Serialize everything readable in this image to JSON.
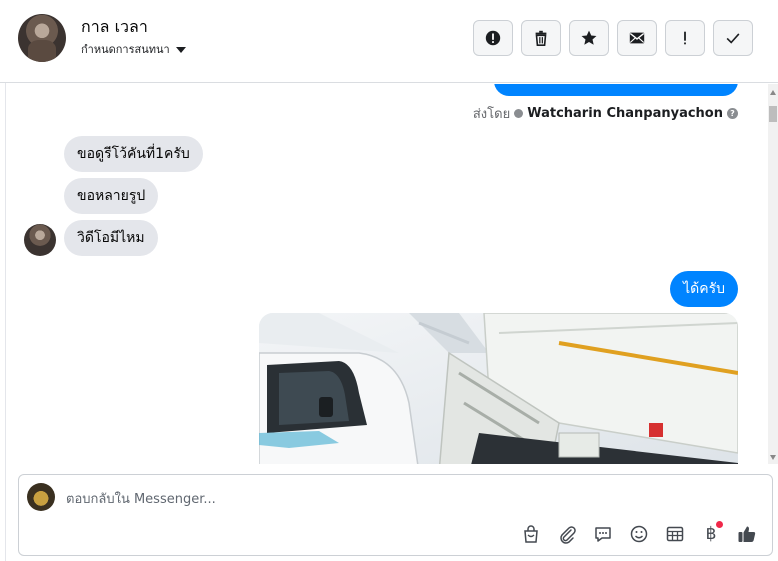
{
  "header": {
    "contact_name": "กาล เวลา",
    "assign_label": "กำหนดการสนทนา",
    "toolbar": [
      {
        "name": "spam-icon",
        "label": "!"
      },
      {
        "name": "trash-icon",
        "label": ""
      },
      {
        "name": "star-icon",
        "label": ""
      },
      {
        "name": "mail-icon",
        "label": ""
      },
      {
        "name": "exclamation-icon",
        "label": "!"
      },
      {
        "name": "check-icon",
        "label": ""
      }
    ]
  },
  "chat": {
    "sent_by_prefix": "ส่งโดย",
    "sent_by_name": "Watcharin Chanpanyachon",
    "incoming": [
      "ขอดูรีโว้คันที่1ครับ",
      "ขอหลายรูป",
      "วิดีโอมีไหม"
    ],
    "outgoing": "ได้ครับ"
  },
  "composer": {
    "placeholder": "ตอบกลับใน Messenger...",
    "icons": [
      "shopping-bag-icon",
      "attachment-icon",
      "saved-reply-icon",
      "emoji-icon",
      "table-icon",
      "baht-icon",
      "like-icon"
    ],
    "baht_symbol": "฿"
  },
  "colors": {
    "messenger_blue": "#0084ff",
    "incoming_bubble": "#e4e6eb",
    "notification_red": "#f02849"
  }
}
